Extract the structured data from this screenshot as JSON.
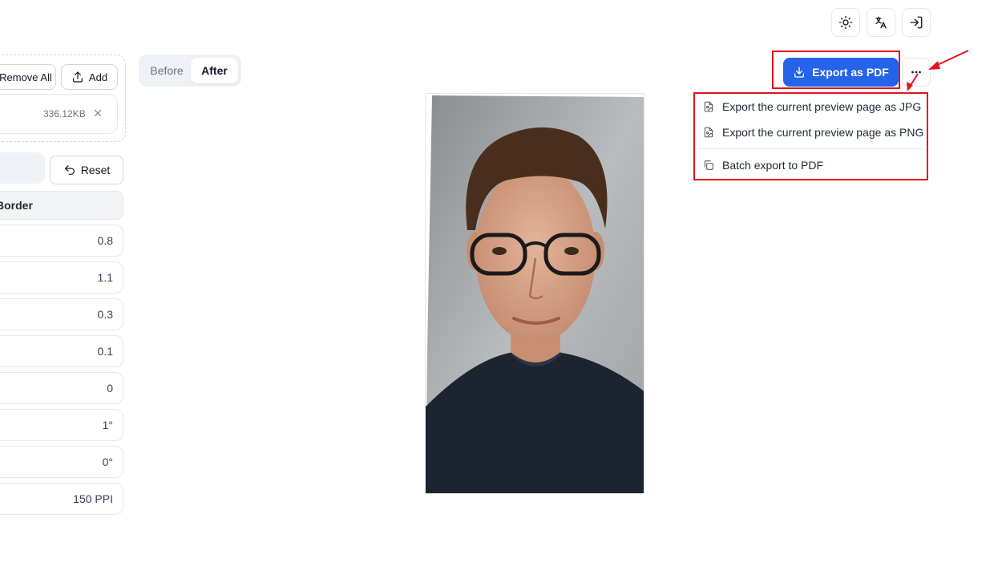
{
  "header": {
    "icons": [
      "sun-icon",
      "translate-icon",
      "sign-in-icon"
    ]
  },
  "left_panel": {
    "remove_all_label": "Remove All",
    "add_label": "Add",
    "file_size": "336.12KB",
    "reset_label": "Reset",
    "active_tab_label": "Border",
    "values": [
      "0.8",
      "1.1",
      "0.3",
      "0.1",
      "0",
      "1°",
      "0°",
      "150 PPI"
    ]
  },
  "view_toggle": {
    "before_label": "Before",
    "after_label": "After",
    "selected": "After"
  },
  "export": {
    "export_pdf_label": "Export as PDF",
    "menu": {
      "jpg_label": "Export the current preview page as JPG",
      "png_label": "Export the current preview page as PNG",
      "batch_label": "Batch export to PDF"
    }
  },
  "colors": {
    "accent": "#2563eb",
    "highlight": "#e0141e"
  }
}
